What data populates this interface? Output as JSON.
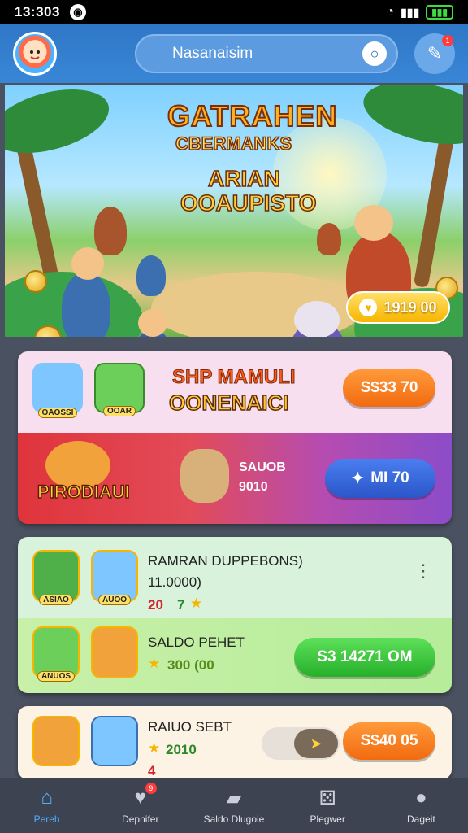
{
  "status_bar": {
    "time": "13:303"
  },
  "header": {
    "title": "Nasanaisim"
  },
  "hero": {
    "title_line1": "GATRAHEN",
    "title_line2": "CBERMANKS",
    "sub_line1": "ARIAN",
    "sub_line2": "OOAUPISTO",
    "badge_value": "1919 00"
  },
  "promo_card": {
    "icon1_label": "OAOSSI",
    "icon2_label": "OOAR",
    "title_line1": "SHP MAMULI",
    "title_line2": "OONENAICI",
    "button_label": "S$33 70",
    "brand": "PIRODIAUI",
    "text_line1": "SAUOB",
    "text_line2": "9010",
    "button2_label": "MI 70"
  },
  "list_card": {
    "row1": {
      "title": "RAMRAN DUPPEBONS)",
      "sub": "11.0000)",
      "tag_red": "20",
      "tag_green": "7",
      "icon1_label": "ASIAO",
      "icon2_label": "AUOO"
    },
    "row2": {
      "title": "SALDO PEHET",
      "sub": "300 (00",
      "button_label": "S3 14271 OM",
      "icon1_label": "ANUOS"
    }
  },
  "last_card": {
    "title": "RAIUO SEBT",
    "sub": "2010",
    "tag": "4",
    "button_label": "S$40 05"
  },
  "bottom_nav": [
    {
      "label": "Pereh",
      "icon": "home-icon"
    },
    {
      "label": "Depnifer",
      "icon": "chat-icon",
      "badge": "9"
    },
    {
      "label": "Saldo Dlugoie",
      "icon": "wallet-icon"
    },
    {
      "label": "Plegwer",
      "icon": "game-icon"
    },
    {
      "label": "Dageit",
      "icon": "user-icon"
    }
  ],
  "colors": {
    "header_blue": "#2f77c7",
    "accent_blue": "#4fb0ff",
    "orange_button": "#f26a10",
    "green_button": "#26b02a"
  }
}
